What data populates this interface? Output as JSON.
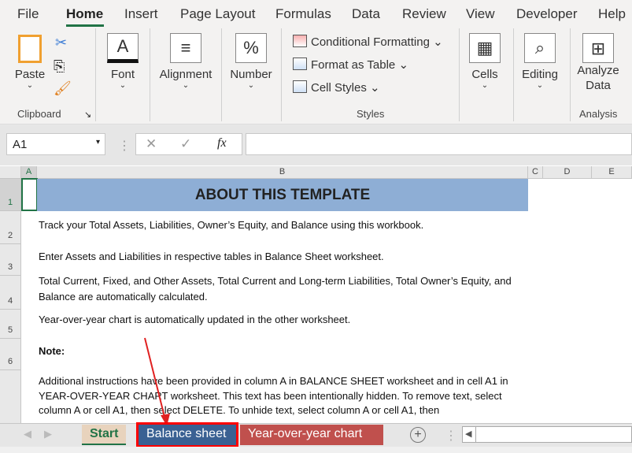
{
  "menu": [
    "File",
    "Home",
    "Insert",
    "Page Layout",
    "Formulas",
    "Data",
    "Review",
    "View",
    "Developer",
    "Help"
  ],
  "ribbon": {
    "paste": "Paste",
    "clipboard": "Clipboard",
    "font": "Font",
    "alignment": "Alignment",
    "number": "Number",
    "conditional_formatting": "Conditional Formatting",
    "format_as_table": "Format as Table",
    "cell_styles": "Cell Styles",
    "styles": "Styles",
    "cells": "Cells",
    "editing": "Editing",
    "analyze_data": "Analyze Data",
    "analysis": "Analysis"
  },
  "formula_bar": {
    "name_box": "A1",
    "fx": "fx",
    "value": ""
  },
  "columns": [
    "A",
    "B",
    "C",
    "D",
    "E"
  ],
  "rows": [
    "1",
    "2",
    "3",
    "4",
    "5",
    "6"
  ],
  "cells": {
    "title": "ABOUT THIS TEMPLATE",
    "b2": "Track your Total Assets, Liabilities, Owner’s Equity, and Balance using this workbook.",
    "b3": "Enter Assets and Liabilities in respective tables in Balance Sheet worksheet.",
    "b4": "Total Current, Fixed, and Other Assets, Total Current and Long-term Liabilities, Total Owner’s Equity, and Balance are automatically calculated.",
    "b5": "Year-over-year chart is automatically updated in the other worksheet.",
    "b6": "Note:",
    "b7": "Additional instructions have been provided in column A in BALANCE SHEET worksheet and in cell A1 in YEAR-OVER-YEAR CHART worksheet. This text has been intentionally hidden. To remove text, select column A or cell A1, then select DELETE. To unhide text, select column A or cell A1, then"
  },
  "sheet_tabs": [
    {
      "label": "Start",
      "color": "#e8d3bd"
    },
    {
      "label": "Balance sheet",
      "color": "#3a6193"
    },
    {
      "label": "Year-over-year chart",
      "color": "#c0504d"
    }
  ],
  "colors": {
    "accent": "#217346",
    "highlight": "#ff0000"
  }
}
